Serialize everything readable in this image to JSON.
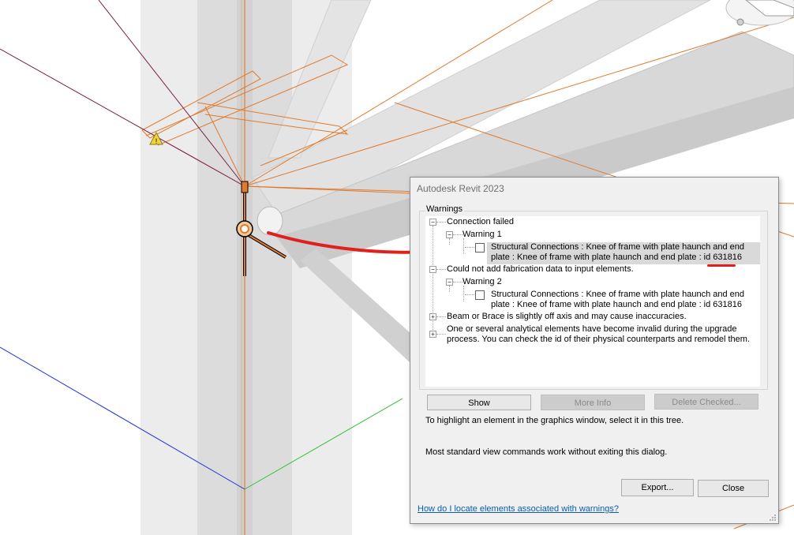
{
  "dialog": {
    "title": "Autodesk Revit 2023",
    "group_label": "Warnings",
    "tree": {
      "connection_failed": "Connection failed",
      "warning1": "Warning 1",
      "item1_line1": "Structural Connections : Knee of frame with plate haunch and end",
      "item1_line2_prefix": "plate : Knee of frame with plate haunch and end plate : id ",
      "item1_id": "631816",
      "could_not_add": "Could not add fabrication data to input elements.",
      "warning2": "Warning 2",
      "item2_line1": "Structural Connections : Knee of frame with plate haunch and end",
      "item2_line2": "plate : Knee of frame with plate haunch and end plate : id 631816",
      "beam_brace": "Beam or Brace is slightly off axis and may cause inaccuracies.",
      "analytical_line1": "One or several analytical elements have become invalid during the upgrade",
      "analytical_line2": "process. You can check the id of their physical counterparts and remodel them."
    },
    "buttons": {
      "show": "Show",
      "more_info": "More Info",
      "delete_checked": "Delete Checked...",
      "export": "Export...",
      "close": "Close"
    },
    "hint1": "To highlight an element in the graphics window, select it in this tree.",
    "hint2": "Most standard view commands work without exiting this dialog.",
    "help_link": "How do I locate elements associated with warnings?"
  },
  "colors": {
    "annotation_red": "#e0201c",
    "model_orange": "#e07b2e",
    "warning_yellow": "#f2d33c"
  },
  "icons": [
    "warning-icon",
    "checkbox",
    "expand-icon",
    "collapse-icon",
    "resize-grip-icon"
  ]
}
